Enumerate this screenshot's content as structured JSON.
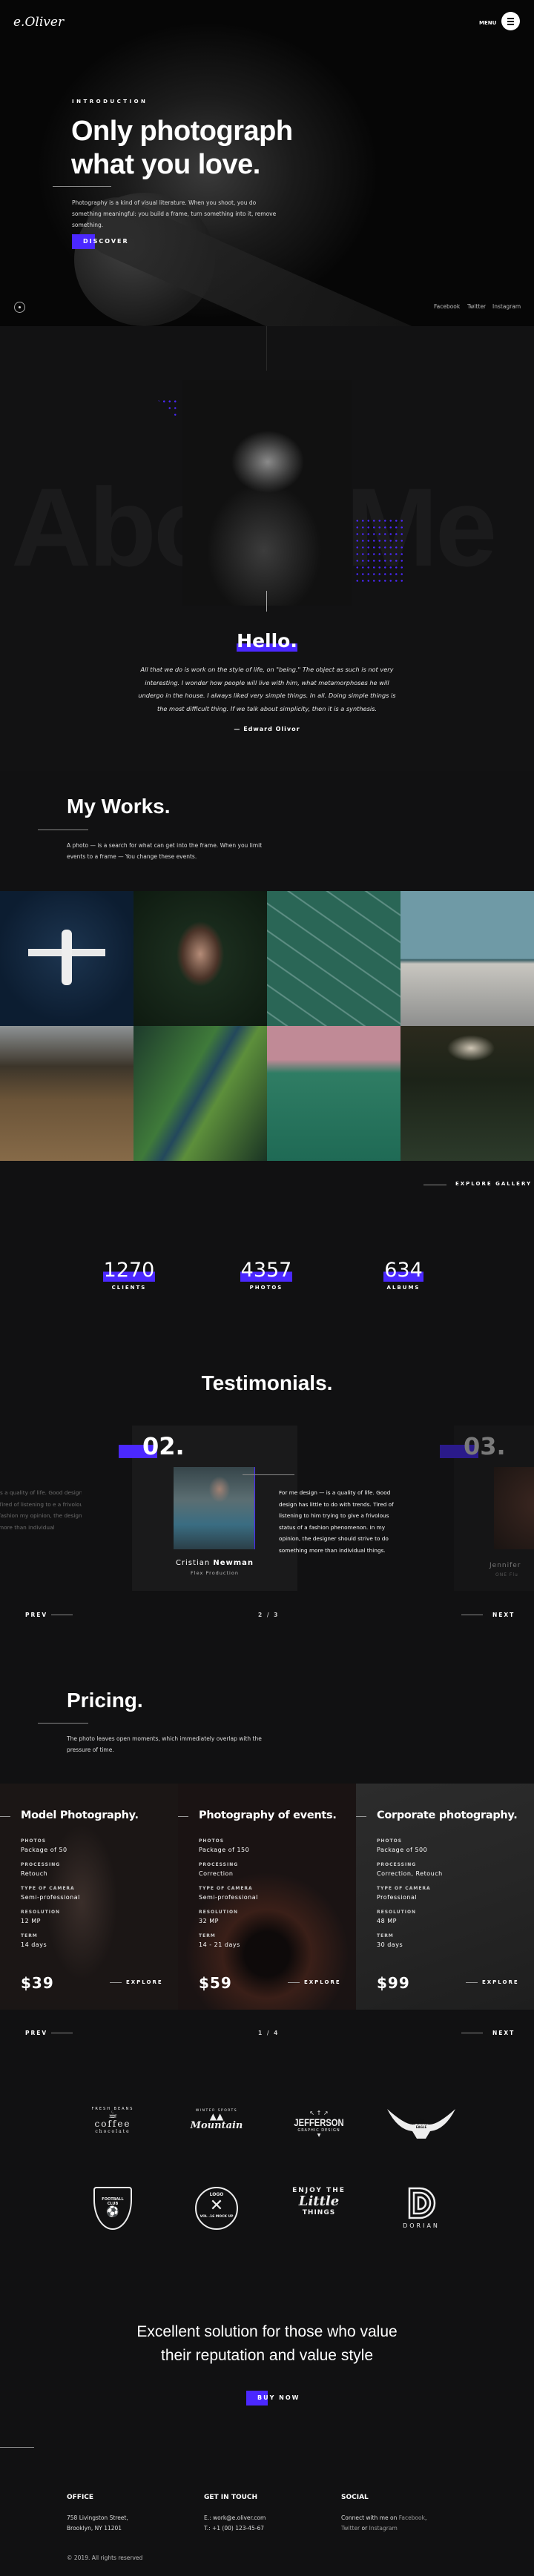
{
  "header": {
    "logo": "e.Oliver",
    "menu_label": "MENU",
    "menu_icon": "hamburger-icon"
  },
  "hero": {
    "eyebrow": "INTRODUCTION",
    "title_line1": "Only photograph",
    "title_line2": "what you love.",
    "text": "Photography is a kind of visual literature. When you shoot, you do something meaningful: you build a frame, turn something into it, remove something.",
    "cta": "DISCOVER",
    "socials": [
      "Facebook",
      "Twitter",
      "Instagram"
    ]
  },
  "about": {
    "background_text": "About Me",
    "heading": "Hello.",
    "quote": "All that we do is work on the style of life, on \"being.\" The object as such is not very interesting. I wonder how people will live with him, what metamorphoses he will undergo in the house. I always liked very simple things. In all. Doing simple things is the most difficult thing. If we talk about simplicity, then it is a synthesis.",
    "signature": "— Edward Olivor"
  },
  "works": {
    "title": "My Works.",
    "text": "A photo — is a search for what can get into the frame. When you limit events to a frame — You change these events.",
    "gallery": [
      "seaplane-aerial",
      "woman-in-leaves",
      "ocean-waves-aerial",
      "skateboarders",
      "person-in-field",
      "river-canyon-aerial",
      "forest-pink-sky",
      "man-in-hat"
    ],
    "explore": "EXPLORE GALLERY"
  },
  "stats": [
    {
      "value": "1270",
      "label": "CLIENTS"
    },
    {
      "value": "4357",
      "label": "PHOTOS"
    },
    {
      "value": "634",
      "label": "ALBUMS"
    }
  ],
  "testimonials": {
    "title": "Testimonials.",
    "active": {
      "number": "02.",
      "first_name": "Cristian",
      "last_name": "Newman",
      "company": "Flex Production",
      "text": "For me design — is a quality of life. Good design has little to do with trends. Tired of listening to him trying to give a frivolous status of a fashion phenomenon. In my opinion, the designer should strive to do something more than individual things."
    },
    "next": {
      "number": "03.",
      "name": "Jennifer",
      "company": "ONE Flu"
    },
    "prev_text": "is a quality of life. Good design th trends. Tired of listening to e a frivolous status of a fashion my opinion, the designer should thing more than individual",
    "prev": "PREV",
    "next_label": "NEXT",
    "page": "2 / 3"
  },
  "pricing": {
    "title": "Pricing.",
    "text": "The photo leaves open moments, which immediately overlap with the pressure of time.",
    "plans": [
      {
        "title": "Model Photography.",
        "items": [
          [
            "PHOTOS",
            "Package of 50"
          ],
          [
            "PROCESSING",
            "Retouch"
          ],
          [
            "TYPE OF CAMERA",
            "Semi-professional"
          ],
          [
            "RESOLUTION",
            "12 MP"
          ],
          [
            "TERM",
            "14 days"
          ]
        ],
        "price": "$39",
        "cta": "EXPLORE"
      },
      {
        "title": "Photography of events.",
        "items": [
          [
            "PHOTOS",
            "Package of 150"
          ],
          [
            "PROCESSING",
            "Correction"
          ],
          [
            "TYPE OF CAMERA",
            "Semi-professional"
          ],
          [
            "RESOLUTION",
            "32 MP"
          ],
          [
            "TERM",
            "14 - 21 days"
          ]
        ],
        "price": "$59",
        "cta": "EXPLORE"
      },
      {
        "title": "Corporate photography.",
        "items": [
          [
            "PHOTOS",
            "Package of 500"
          ],
          [
            "PROCESSING",
            "Correction, Retouch"
          ],
          [
            "TYPE OF CAMERA",
            "Professional"
          ],
          [
            "RESOLUTION",
            "48 MP"
          ],
          [
            "TERM",
            "30 days"
          ]
        ],
        "price": "$99",
        "cta": "EXPLORE"
      }
    ],
    "prev": "PREV",
    "next": "NEXT",
    "page": "1 / 4"
  },
  "clients": [
    {
      "main": "coffee",
      "sub": "chocolate",
      "top": "FRESH BEANS"
    },
    {
      "main": "Mountain",
      "top": "WINTER SPORTS"
    },
    {
      "main": "JEFFERSON",
      "sub": "GRAPHIC DESIGN"
    },
    {
      "main": "The AMERICAN EAGLE"
    },
    {
      "main": "FOOTBALL CLUB"
    },
    {
      "main": "LOGO",
      "sub": "VOL .16 MOCK UP"
    },
    {
      "main": "ENJOY THE",
      "sub": "Little",
      "bottom": "THINGS"
    },
    {
      "main": "DORIAN"
    }
  ],
  "cta": {
    "line1": "Excellent solution for those who value",
    "line2": "their reputation and value style",
    "button": "BUY NOW"
  },
  "footer": {
    "office": {
      "title": "OFFICE",
      "line1": "758 Livingston Street,",
      "line2": "Brooklyn, NY 11201"
    },
    "contact": {
      "title": "GET IN TOUCH",
      "email": "E.: work@e.oliver.com",
      "phone": "T.: +1 (00) 123-45-67"
    },
    "social": {
      "title": "SOCIAL",
      "prefix": "Connect with me on",
      "links": [
        "Facebook",
        "Twitter",
        "Instagram"
      ],
      "or": "or"
    },
    "copyright": "© 2019. All rights reserved"
  },
  "colors": {
    "accent": "#4b28ff",
    "background": "#111112"
  }
}
